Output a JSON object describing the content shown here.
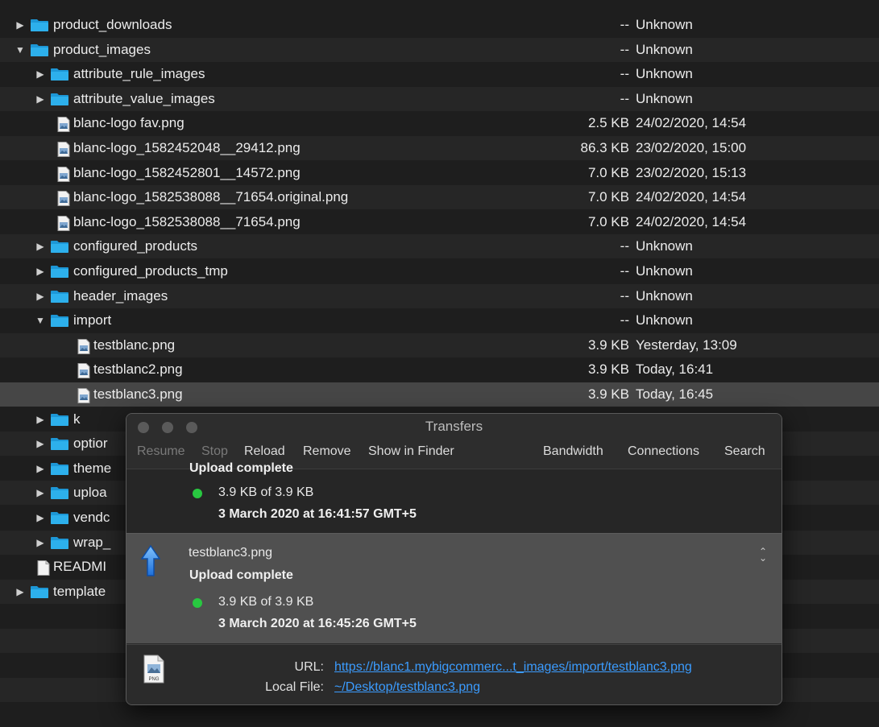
{
  "rows": [
    {
      "name": "product_downloads",
      "type": "folder",
      "indent": 0,
      "disclosure": "▶",
      "size": "--",
      "date": "Unknown"
    },
    {
      "name": "product_images",
      "type": "folder",
      "indent": 0,
      "disclosure": "▼",
      "size": "--",
      "date": "Unknown"
    },
    {
      "name": "attribute_rule_images",
      "type": "folder",
      "indent": 1,
      "disclosure": "▶",
      "size": "--",
      "date": "Unknown"
    },
    {
      "name": "attribute_value_images",
      "type": "folder",
      "indent": 1,
      "disclosure": "▶",
      "size": "--",
      "date": "Unknown"
    },
    {
      "name": "blanc-logo fav.png",
      "type": "image",
      "indent": 1,
      "disclosure": "",
      "size": "2.5 KB",
      "date": "24/02/2020, 14:54"
    },
    {
      "name": "blanc-logo_1582452048__29412.png",
      "type": "image",
      "indent": 1,
      "disclosure": "",
      "size": "86.3 KB",
      "date": "23/02/2020, 15:00"
    },
    {
      "name": "blanc-logo_1582452801__14572.png",
      "type": "image",
      "indent": 1,
      "disclosure": "",
      "size": "7.0 KB",
      "date": "23/02/2020, 15:13"
    },
    {
      "name": "blanc-logo_1582538088__71654.original.png",
      "type": "image",
      "indent": 1,
      "disclosure": "",
      "size": "7.0 KB",
      "date": "24/02/2020, 14:54"
    },
    {
      "name": "blanc-logo_1582538088__71654.png",
      "type": "image",
      "indent": 1,
      "disclosure": "",
      "size": "7.0 KB",
      "date": "24/02/2020, 14:54"
    },
    {
      "name": "configured_products",
      "type": "folder",
      "indent": 1,
      "disclosure": "▶",
      "size": "--",
      "date": "Unknown"
    },
    {
      "name": "configured_products_tmp",
      "type": "folder",
      "indent": 1,
      "disclosure": "▶",
      "size": "--",
      "date": "Unknown"
    },
    {
      "name": "header_images",
      "type": "folder",
      "indent": 1,
      "disclosure": "▶",
      "size": "--",
      "date": "Unknown"
    },
    {
      "name": "import",
      "type": "folder",
      "indent": 1,
      "disclosure": "▼",
      "size": "--",
      "date": "Unknown"
    },
    {
      "name": "testblanc.png",
      "type": "image",
      "indent": 2,
      "disclosure": "",
      "size": "3.9 KB",
      "date": "Yesterday, 13:09"
    },
    {
      "name": "testblanc2.png",
      "type": "image",
      "indent": 2,
      "disclosure": "",
      "size": "3.9 KB",
      "date": "Today, 16:41"
    },
    {
      "name": "testblanc3.png",
      "type": "image",
      "indent": 2,
      "disclosure": "",
      "size": "3.9 KB",
      "date": "Today, 16:45",
      "selected": true
    },
    {
      "name": "k",
      "type": "folder",
      "indent": 1,
      "disclosure": "▶",
      "size": "",
      "date": ""
    },
    {
      "name": "optior",
      "type": "folder",
      "indent": 1,
      "disclosure": "▶",
      "size": "",
      "date": ""
    },
    {
      "name": "theme",
      "type": "folder",
      "indent": 1,
      "disclosure": "▶",
      "size": "",
      "date": ""
    },
    {
      "name": "uploa",
      "type": "folder",
      "indent": 1,
      "disclosure": "▶",
      "size": "",
      "date": ""
    },
    {
      "name": "vendc",
      "type": "folder",
      "indent": 1,
      "disclosure": "▶",
      "size": "",
      "date": ""
    },
    {
      "name": "wrap_",
      "type": "folder",
      "indent": 1,
      "disclosure": "▶",
      "size": "",
      "date": ""
    },
    {
      "name": "READMI",
      "type": "document",
      "indent": 0,
      "disclosure": "",
      "size": "",
      "date": ""
    },
    {
      "name": "template",
      "type": "folder",
      "indent": 0,
      "disclosure": "▶",
      "size": "",
      "date": ""
    },
    {
      "name": "",
      "type": "empty",
      "indent": 0,
      "disclosure": "",
      "size": "",
      "date": ""
    },
    {
      "name": "",
      "type": "empty",
      "indent": 0,
      "disclosure": "",
      "size": "",
      "date": ""
    },
    {
      "name": "",
      "type": "empty",
      "indent": 0,
      "disclosure": "",
      "size": "",
      "date": ""
    },
    {
      "name": "",
      "type": "empty",
      "indent": 0,
      "disclosure": "",
      "size": "",
      "date": ""
    },
    {
      "name": "",
      "type": "empty",
      "indent": 0,
      "disclosure": "",
      "size": "",
      "date": ""
    }
  ],
  "transfers": {
    "title": "Transfers",
    "toolbar_left": [
      {
        "label": "Resume",
        "enabled": false
      },
      {
        "label": "Stop",
        "enabled": false
      },
      {
        "label": "Reload",
        "enabled": true
      },
      {
        "label": "Remove",
        "enabled": true
      },
      {
        "label": "Show in Finder",
        "enabled": true
      }
    ],
    "toolbar_right": [
      {
        "label": "Bandwidth",
        "enabled": true
      },
      {
        "label": "Connections",
        "enabled": true
      },
      {
        "label": "Search",
        "enabled": true
      }
    ],
    "entries": [
      {
        "file": "",
        "status": "Upload complete",
        "progress": "3.9 KB of 3.9 KB",
        "date": "3 March 2020 at 16:41:57 GMT+5"
      },
      {
        "file": "testblanc3.png",
        "status": "Upload complete",
        "progress": "3.9 KB of 3.9 KB",
        "date": "3 March 2020 at 16:45:26 GMT+5"
      }
    ],
    "details": {
      "url_label": "URL:",
      "url": "https://blanc1.mybigcommerc...t_images/import/testblanc3.png",
      "local_label": "Local File:",
      "local": "~/Desktop/testblanc3.png",
      "file_icon_text": "PNG"
    },
    "colors": {
      "status_dot": "#28c840",
      "link": "#3b9cff"
    }
  }
}
